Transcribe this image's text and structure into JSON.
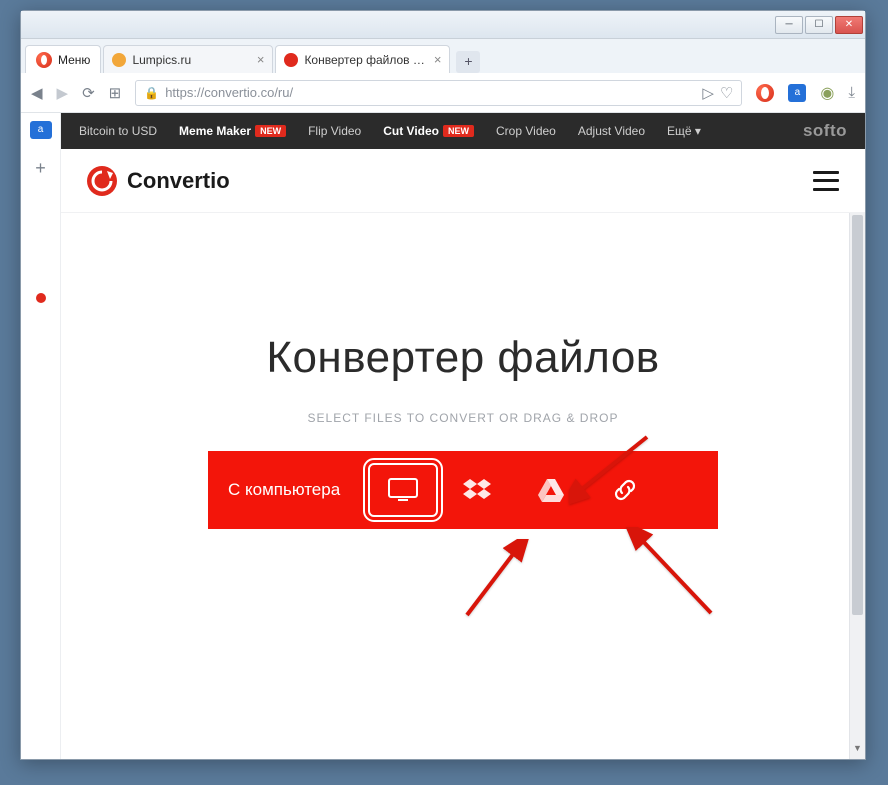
{
  "window": {
    "minimize_glyph": "─",
    "maximize_glyph": "☐",
    "close_glyph": "✕"
  },
  "browser": {
    "menu_label": "Меню",
    "tabs": [
      {
        "title": "Lumpics.ru",
        "favicon": "#f2a73a",
        "active": false
      },
      {
        "title": "Конвертер файлов — Co",
        "favicon": "#e02a1d",
        "active": true
      }
    ],
    "newtab_glyph": "+",
    "nav": {
      "back": "◀",
      "forward": "▶",
      "reload": "⟳",
      "speed": "⊞"
    },
    "url_proto": "https://",
    "url_rest": "convertio.co/ru/",
    "sendto_glyph": "▷",
    "heart_glyph": "♡",
    "download_glyph": "⤓"
  },
  "softo": {
    "items": [
      {
        "label": "Bitcoin to USD",
        "bold": false,
        "new": false
      },
      {
        "label": "Meme Maker",
        "bold": true,
        "new": true
      },
      {
        "label": "Flip Video",
        "bold": false,
        "new": false
      },
      {
        "label": "Cut Video",
        "bold": true,
        "new": true
      },
      {
        "label": "Crop Video",
        "bold": false,
        "new": false
      },
      {
        "label": "Adjust Video",
        "bold": false,
        "new": false
      }
    ],
    "more_label": "Ещё",
    "new_pill": "NEW",
    "logo": "softo"
  },
  "brand": {
    "name": "Convertio"
  },
  "hero": {
    "title": "Конвертер файлов",
    "subtitle": "SELECT FILES TO CONVERT OR DRAG & DROP"
  },
  "upload": {
    "from_computer": "С компьютера"
  },
  "gutter": {
    "translate": "a",
    "plus": "+"
  }
}
